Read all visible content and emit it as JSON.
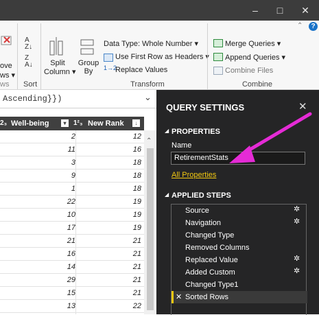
{
  "titlebar": {
    "minimize": "–",
    "maximize": "□",
    "close": "✕"
  },
  "ribbon": {
    "remove_rows_line1": "ove",
    "remove_rows_line2": "ws ▾",
    "group_rows_label": "ws",
    "sort_label": "Sort",
    "split_column_line1": "Split",
    "split_column_line2": "Column ▾",
    "group_by_line1": "Group",
    "group_by_line2": "By",
    "data_type": "Data Type: Whole Number ▾",
    "first_row_headers": "Use First Row as Headers ▾",
    "replace_values": "Replace Values",
    "transform_label": "Transform",
    "merge_queries": "Merge Queries ▾",
    "append_queries": "Append Queries ▾",
    "combine_files": "Combine Files",
    "combine_label": "Combine"
  },
  "formula": {
    "text": "Ascending}})",
    "chevron": "⌄"
  },
  "table": {
    "col1_type": "2₃",
    "col1_header": "Well-being",
    "col2_type": "1²₃",
    "col2_header": "New Rank",
    "rows": [
      [
        "2",
        "12"
      ],
      [
        "11",
        "16"
      ],
      [
        "3",
        "18"
      ],
      [
        "9",
        "18"
      ],
      [
        "1",
        "18"
      ],
      [
        "22",
        "19"
      ],
      [
        "10",
        "19"
      ],
      [
        "17",
        "19"
      ],
      [
        "21",
        "21"
      ],
      [
        "16",
        "21"
      ],
      [
        "14",
        "21"
      ],
      [
        "29",
        "21"
      ],
      [
        "15",
        "21"
      ],
      [
        "13",
        "22"
      ]
    ]
  },
  "query_settings": {
    "title": "QUERY SETTINGS",
    "close": "✕",
    "properties_header": "PROPERTIES",
    "name_label": "Name",
    "name_value": "RetirementStats",
    "all_properties": "All Properties",
    "applied_steps_header": "APPLIED STEPS",
    "steps": [
      {
        "label": "Source",
        "gear": true
      },
      {
        "label": "Navigation",
        "gear": true
      },
      {
        "label": "Changed Type",
        "gear": false
      },
      {
        "label": "Removed Columns",
        "gear": false
      },
      {
        "label": "Replaced Value",
        "gear": true
      },
      {
        "label": "Added Custom",
        "gear": true
      },
      {
        "label": "Changed Type1",
        "gear": false
      },
      {
        "label": "Sorted Rows",
        "gear": false
      }
    ]
  },
  "colors": {
    "accent_pink": "#e52bd6",
    "link_yellow": "#f2c811",
    "panel_bg": "#252526"
  }
}
